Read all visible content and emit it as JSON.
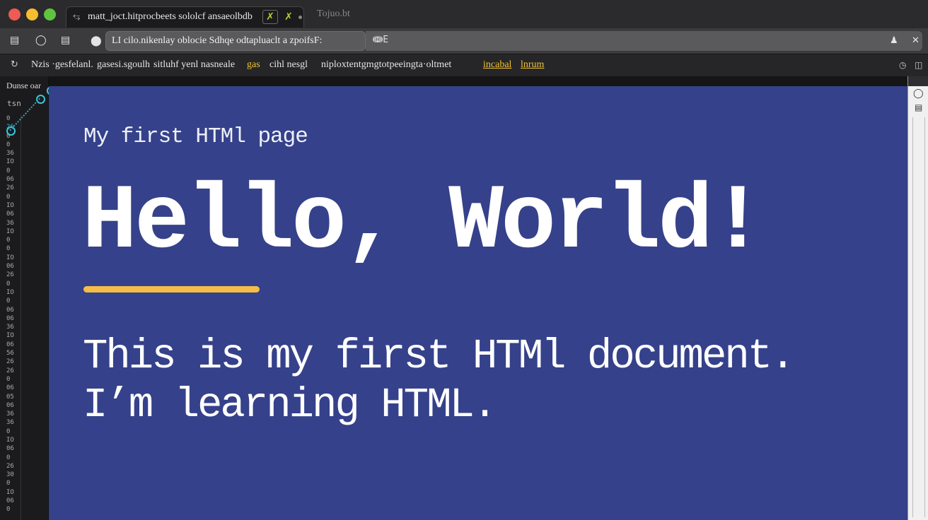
{
  "tab": {
    "title": "matt_joct.hitprocbeets sololcf ansaeolbdb",
    "extra": "Tojuo.bt",
    "marks": [
      "✗",
      "✗"
    ]
  },
  "nav": {
    "address_text": "LI cilo.nikenlay oblocie Sdhqe odtapluaclt a zpoifsF:",
    "side_label": "ↈE"
  },
  "bookmarks": {
    "seg1": "Nzis ·gesfelanl.",
    "seg2": "gasesi.sgoulh",
    "seg3": "sitluhf yenl nasneale",
    "seg4_yellow": "gas",
    "seg5": "cihl nesgl",
    "seg6": "niploxtentgmgtotpeeingta·oltmet",
    "link1": "incabal",
    "link2": "lnrum"
  },
  "gutter": {
    "header": "Dunse oar",
    "tab_label": "tsn",
    "line_numbers": [
      "0",
      "26",
      "0",
      "0",
      "36",
      "IO",
      "0",
      "06",
      "26",
      "0",
      "IO",
      "06",
      "36",
      "IO",
      "0",
      "0",
      "IO",
      "06",
      "26",
      "0",
      "IO",
      "0",
      "06",
      "06",
      "36",
      "IO",
      "06",
      "56",
      "26",
      "26",
      "0",
      "06",
      "05",
      "06",
      "36",
      "36",
      "0",
      "IO",
      "06",
      "0",
      "26",
      "30",
      "0",
      "IO",
      "06",
      "0"
    ]
  },
  "page": {
    "subtitle": "My first HTMl page",
    "heading": "Hello, World!",
    "body_line1": "This is my first HTMl document.",
    "body_line2": "I’m learning HTML."
  },
  "colors": {
    "content_bg": "#35418a",
    "accent_underline": "#f5bd45",
    "traffic_red": "#ee5b55",
    "traffic_yellow": "#f5bd2f",
    "traffic_green": "#5fc53f"
  },
  "icons": {
    "back": "back-icon",
    "forward": "refresh-icon",
    "sidebar": "sidebar-icon",
    "user": "user-icon",
    "close": "close-icon"
  }
}
